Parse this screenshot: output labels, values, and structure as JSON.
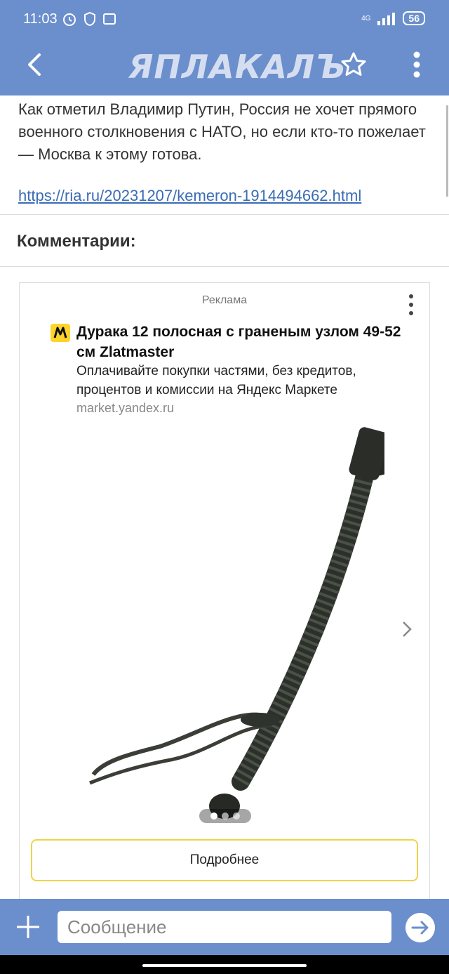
{
  "status": {
    "time": "11:03",
    "network": "4G",
    "battery": "56"
  },
  "header": {
    "logo": "ЯПЛАКАЛЪ"
  },
  "article": {
    "text": "Как отметил Владимир Путин, Россия не хочет прямого военного столкновения с НАТО, но если кто-то пожелает — Москва к этому готова.",
    "link": "https://ria.ru/20231207/kemeron-1914494662.html"
  },
  "comments": {
    "title": "Комментарии:"
  },
  "ad": {
    "label": "Реклама",
    "title": "Дурака 12 полосная с граненым узлом 49-52 см Zlatmaster",
    "description": "Оплачивайте покупки частями, без кредитов, процентов и комиссии на Яндекс Маркете",
    "domain": "market.yandex.ru",
    "image_icon": "braided-whip-image",
    "carousel": {
      "count": 3,
      "active": 1
    },
    "button_label": "Подробнее"
  },
  "composer": {
    "placeholder": "Сообщение"
  },
  "colors": {
    "accent": "#6b8fcc",
    "link": "#3b6cb5",
    "button_border": "#f0d24a"
  }
}
